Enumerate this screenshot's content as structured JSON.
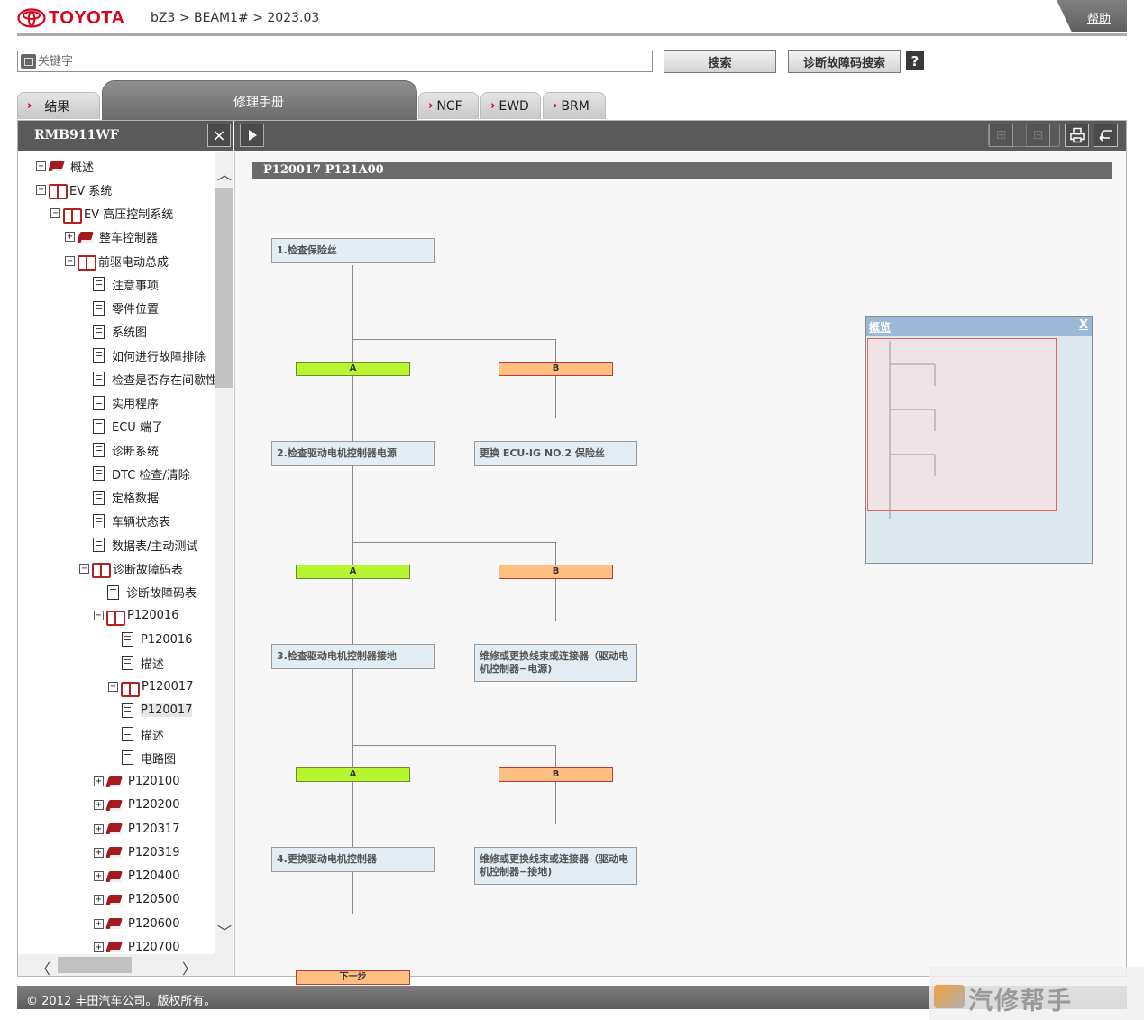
{
  "header": {
    "brand": "TOYOTA",
    "breadcrumb": "bZ3 > BEAM1# > 2023.03",
    "help": "帮助"
  },
  "search": {
    "placeholder": "关键字",
    "search_button": "搜索",
    "dtc_button": "诊断故障码搜索",
    "help_icon": "?"
  },
  "tabs": [
    {
      "label": "结果"
    },
    {
      "label": "修理手册"
    },
    {
      "label": "NCF"
    },
    {
      "label": "EWD"
    },
    {
      "label": "BRM"
    }
  ],
  "left_panel": {
    "title": "RMB911WF",
    "close": "×"
  },
  "tree": [
    {
      "label": "概述",
      "toggle": "+",
      "icon": "book-closed"
    },
    {
      "label": "EV 系统",
      "toggle": "−",
      "icon": "book-open"
    },
    {
      "label": "EV 高压控制系统",
      "toggle": "−",
      "icon": "book-open"
    },
    {
      "label": "整车控制器",
      "toggle": "+",
      "icon": "book-closed"
    },
    {
      "label": "前驱电动总成",
      "toggle": "−",
      "icon": "book-open"
    },
    {
      "label": "注意事项",
      "icon": "document"
    },
    {
      "label": "零件位置",
      "icon": "document"
    },
    {
      "label": "系统图",
      "icon": "document"
    },
    {
      "label": "如何进行故障排除",
      "icon": "document"
    },
    {
      "label": "检查是否存在间歇性",
      "icon": "document"
    },
    {
      "label": "实用程序",
      "icon": "document"
    },
    {
      "label": "ECU 端子",
      "icon": "document"
    },
    {
      "label": "诊断系统",
      "icon": "document"
    },
    {
      "label": "DTC 检查/清除",
      "icon": "document"
    },
    {
      "label": "定格数据",
      "icon": "document"
    },
    {
      "label": "车辆状态表",
      "icon": "document"
    },
    {
      "label": "数据表/主动测试",
      "icon": "document"
    },
    {
      "label": "诊断故障码表",
      "toggle": "−",
      "icon": "book-open"
    },
    {
      "label": "诊断故障码表",
      "icon": "document"
    },
    {
      "label": "P120016",
      "toggle": "−",
      "icon": "book-open"
    },
    {
      "label": "P120016",
      "icon": "document"
    },
    {
      "label": "描述",
      "icon": "document"
    },
    {
      "label": "P120017",
      "toggle": "−",
      "icon": "book-open"
    },
    {
      "label": "P120017",
      "icon": "document",
      "selected": true
    },
    {
      "label": "描述",
      "icon": "document"
    },
    {
      "label": "电路图",
      "icon": "document"
    },
    {
      "label": "P120100",
      "toggle": "+",
      "icon": "book-closed"
    },
    {
      "label": "P120200",
      "toggle": "+",
      "icon": "book-closed"
    },
    {
      "label": "P120317",
      "toggle": "+",
      "icon": "book-closed"
    },
    {
      "label": "P120319",
      "toggle": "+",
      "icon": "book-closed"
    },
    {
      "label": "P120400",
      "toggle": "+",
      "icon": "book-closed"
    },
    {
      "label": "P120500",
      "toggle": "+",
      "icon": "book-closed"
    },
    {
      "label": "P120600",
      "toggle": "+",
      "icon": "book-closed"
    },
    {
      "label": "P120700",
      "toggle": "+",
      "icon": "book-closed"
    }
  ],
  "content": {
    "title": "P120017  P121A00",
    "steps": {
      "s1": "1.检查保险丝",
      "s2": "2.检查驱动电机控制器电源",
      "s3": "3.检查驱动电机控制器接地",
      "s4": "4.更换驱动电机控制器",
      "r1": "更换 ECU-IG NO.2 保险丝",
      "r2": "维修或更换线束或连接器（驱动电机控制器−电源)",
      "r3": "维修或更换线束或连接器（驱动电机控制器−接地)"
    },
    "branch_a": "A",
    "branch_b": "B",
    "next": "下一步"
  },
  "overview": {
    "title": "概览",
    "close": "X"
  },
  "footer": {
    "copyright": "© 2012 丰田汽车公司。版权所有。"
  },
  "watermark": "汽修帮手"
}
